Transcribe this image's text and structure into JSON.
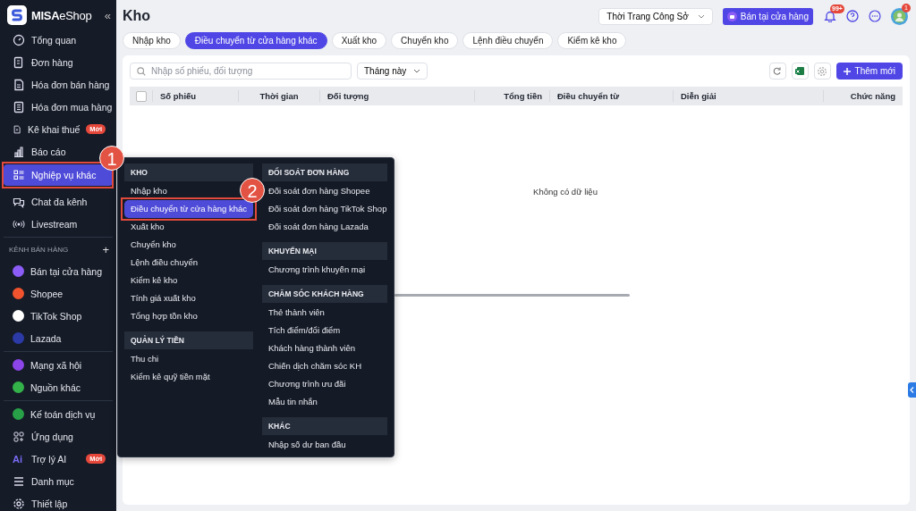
{
  "sidebar": {
    "brand": "MISA",
    "brand_suffix": "eShop",
    "collapse": "«",
    "groups": [
      {
        "items": [
          {
            "kind": "nav",
            "label": "Tổng quan",
            "selected": false
          },
          {
            "kind": "nav",
            "label": "Đơn hàng",
            "selected": false
          },
          {
            "kind": "nav",
            "label": "Hóa đơn bán hàng",
            "selected": false
          },
          {
            "kind": "nav",
            "label": "Hóa đơn mua hàng",
            "selected": false
          },
          {
            "kind": "nav",
            "label": "Kê khai thuế",
            "selected": false,
            "badge": "Mới"
          },
          {
            "kind": "nav",
            "label": "Báo cáo",
            "selected": false
          },
          {
            "kind": "nav",
            "label": "Nghiệp vụ khác",
            "selected": true
          },
          {
            "kind": "nav",
            "label": "Chat đa kênh",
            "selected": false
          },
          {
            "kind": "nav",
            "label": "Livestream",
            "selected": false
          }
        ]
      },
      {
        "heading": "KÊNH BÁN HÀNG",
        "action": "+",
        "items": [
          {
            "kind": "channel",
            "label": "Bán tại cửa hàng",
            "selected": false,
            "color": "#8b5cf6"
          },
          {
            "kind": "channel",
            "label": "Shopee",
            "selected": false,
            "color": "#f0532d"
          },
          {
            "kind": "channel",
            "label": "TikTok Shop",
            "selected": false,
            "color": "#ffffff"
          },
          {
            "kind": "channel",
            "label": "Lazada",
            "selected": false,
            "color": "#2b3aa6"
          }
        ]
      },
      {
        "items": [
          {
            "kind": "channel",
            "label": "Mạng xã hội",
            "selected": false,
            "color": "#8b45e8"
          },
          {
            "kind": "channel",
            "label": "Nguồn khác",
            "selected": false,
            "color": "#34b24a"
          }
        ]
      },
      {
        "items": [
          {
            "kind": "channel",
            "label": "Kế toán dịch vụ",
            "selected": false,
            "color": "#27a048"
          },
          {
            "kind": "nav",
            "label": "Ứng dụng",
            "selected": false
          },
          {
            "kind": "text_icon",
            "icon_text": "Ai",
            "label": "Trợ lý AI",
            "selected": false,
            "badge": "Mới"
          },
          {
            "kind": "nav",
            "label": "Danh mục",
            "selected": false
          },
          {
            "kind": "nav",
            "label": "Thiết lập",
            "selected": false
          }
        ]
      }
    ]
  },
  "header": {
    "title": "Kho",
    "store": "Thời Trang Công Sở",
    "pos_button": "Bán tại cửa hàng",
    "notification_count": "99+",
    "avatar_badge": "1"
  },
  "tabs": [
    {
      "label": "Nhập kho",
      "selected": false
    },
    {
      "label": "Điều chuyển từ cửa hàng khác",
      "selected": true
    },
    {
      "label": "Xuất kho",
      "selected": false
    },
    {
      "label": "Chuyển kho",
      "selected": false
    },
    {
      "label": "Lệnh điều chuyển",
      "selected": false
    },
    {
      "label": "Kiểm kê kho",
      "selected": false
    }
  ],
  "toolbar": {
    "search": {
      "placeholder": "Nhập số phiếu, đối tượng"
    },
    "period": "Tháng này",
    "add_button": "Thêm mới"
  },
  "table": {
    "select_all_checked": false,
    "columns": [
      "Số phiếu",
      "Thời gian",
      "Đối tượng",
      "Tổng tiền",
      "Điều chuyển từ",
      "Diễn giải",
      "Chức năng"
    ],
    "empty_text": "Không có dữ liệu"
  },
  "menu": {
    "columns": [
      [
        {
          "heading": "KHO",
          "items": [
            {
              "label": "Nhập kho",
              "selected": false
            },
            {
              "label": "Điều chuyển từ cửa hàng khác",
              "selected": true
            },
            {
              "label": "Xuất kho",
              "selected": false
            },
            {
              "label": "Chuyển kho",
              "selected": false
            },
            {
              "label": "Lệnh điều chuyển",
              "selected": false
            },
            {
              "label": "Kiểm kê kho",
              "selected": false
            },
            {
              "label": "Tính giá xuất kho",
              "selected": false
            },
            {
              "label": "Tổng hợp tồn kho",
              "selected": false
            }
          ]
        },
        {
          "heading": "QUẢN LÝ TIỀN",
          "items": [
            {
              "label": "Thu chi",
              "selected": false
            },
            {
              "label": "Kiểm kê quỹ tiền mặt",
              "selected": false
            }
          ]
        }
      ],
      [
        {
          "heading": "ĐỐI SOÁT ĐƠN HÀNG",
          "items": [
            {
              "label": "Đối soát đơn hàng Shopee",
              "selected": false
            },
            {
              "label": "Đối soát đơn hàng TikTok Shop",
              "selected": false
            },
            {
              "label": "Đối soát đơn hàng Lazada",
              "selected": false
            }
          ]
        },
        {
          "heading": "KHUYẾN MẠI",
          "items": [
            {
              "label": "Chương trình khuyến mại",
              "selected": false
            }
          ]
        },
        {
          "heading": "CHĂM SÓC KHÁCH HÀNG",
          "items": [
            {
              "label": "Thẻ thành viên",
              "selected": false
            },
            {
              "label": "Tích điểm/đổi điểm",
              "selected": false
            },
            {
              "label": "Khách hàng thành viên",
              "selected": false
            },
            {
              "label": "Chiến dịch chăm sóc KH",
              "selected": false
            },
            {
              "label": "Chương trình ưu đãi",
              "selected": false
            },
            {
              "label": "Mẫu tin nhắn",
              "selected": false
            }
          ]
        },
        {
          "heading": "KHÁC",
          "items": [
            {
              "label": "Nhập số dư ban đầu",
              "selected": false
            }
          ]
        }
      ]
    ]
  },
  "annotations": [
    {
      "label": "1"
    },
    {
      "label": "2"
    }
  ]
}
